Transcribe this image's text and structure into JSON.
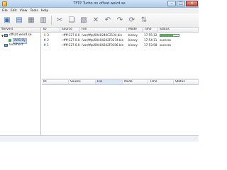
{
  "window": {
    "title": "TFTP Turbo on offsat.weird.se",
    "minimize_glyph": "–",
    "maximize_glyph": "□",
    "close_glyph": "✕"
  },
  "menu": [
    "File",
    "Edit",
    "View",
    "Tools",
    "Help"
  ],
  "toolbar": {
    "buttons": [
      {
        "name": "new-server-icon",
        "glyph": "▣"
      },
      {
        "name": "save-icon",
        "glyph": "▤"
      },
      {
        "name": "print-icon",
        "glyph": "▦"
      },
      {
        "name": "properties-icon",
        "glyph": "▥"
      },
      {
        "name": "cut-icon",
        "glyph": "✂"
      },
      {
        "name": "copy-icon",
        "glyph": "❏"
      },
      {
        "name": "paste-icon",
        "glyph": "▧"
      },
      {
        "name": "delete-icon",
        "glyph": "✕"
      },
      {
        "name": "undo-icon",
        "glyph": "↶"
      },
      {
        "name": "redo-icon",
        "glyph": "↷"
      },
      {
        "name": "refresh-icon",
        "glyph": "⟳"
      },
      {
        "name": "connect-icon",
        "glyph": "⇅"
      }
    ]
  },
  "servers": {
    "header": "Servers",
    "items": [
      {
        "label": "offsat.weird.se",
        "expanded": true,
        "children": [
          {
            "label": "Activity",
            "selected": true
          }
        ]
      },
      {
        "label": "localhost",
        "expanded": false,
        "children": []
      }
    ]
  },
  "transfers": {
    "columns": [
      "ID",
      "Source",
      "File",
      "Mode",
      "Time",
      "Status"
    ],
    "rows": [
      {
        "id": "3",
        "direction": "down",
        "source": "::ffff:127.0.0.1",
        "file": "/var/tftp/0040240C2134.bin",
        "mode": "binary",
        "time": "17:55:12",
        "status": "",
        "progress": 0.68
      },
      {
        "id": "2",
        "direction": "up",
        "source": "::ffff:127.0.0.1",
        "file": "/var/tftp/00404242F0274.bin",
        "mode": "binary",
        "time": "17:54:11",
        "status": "success",
        "progress": null
      },
      {
        "id": "1",
        "direction": "up",
        "source": "::ffff:127.0.0.1",
        "file": "/var/tftp/00404242F0106.bin",
        "mode": "binary",
        "time": "17:53:58",
        "status": "success",
        "progress": null
      }
    ]
  },
  "details": {
    "columns": [
      "ID",
      "Source",
      "File",
      "Mode",
      "Time",
      "Status"
    ],
    "active_column": "File"
  },
  "colors": {
    "accent": "#3a6fb8",
    "progress": "#2ea52e",
    "selection": "#cfe0f3"
  }
}
